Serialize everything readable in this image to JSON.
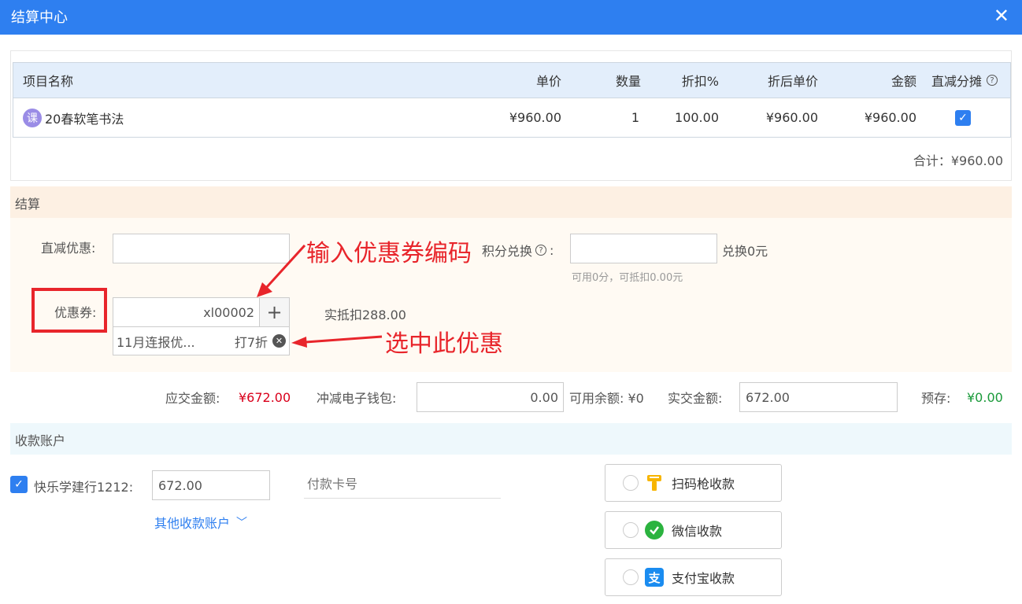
{
  "window": {
    "title": "结算中心",
    "close_glyph": "✕"
  },
  "table": {
    "headers": [
      "项目名称",
      "单价",
      "数量",
      "折扣%",
      "折后单价",
      "金额",
      "直减分摊"
    ],
    "rows": [
      {
        "type_badge": "课",
        "name": "20春软笔书法",
        "unit_price": "¥960.00",
        "qty": "1",
        "discount": "100.00",
        "disc_price": "¥960.00",
        "amount": "¥960.00",
        "allocate_checked": true
      }
    ],
    "total": "合计：¥960.00"
  },
  "settle": {
    "section_title": "结算",
    "direct_discount_label": "直减优惠:",
    "direct_discount_value": "",
    "points_label": "积分兑换",
    "points_value": "",
    "points_suffix": "兑换0元",
    "points_hint": "可用0分，可抵扣0.00元",
    "coupon_label": "优惠券:",
    "coupon_code": "xl00002",
    "coupon_add_glyph": "+",
    "coupon_deduct": "实抵扣288.00",
    "coupon_item_name": "11月连报优...",
    "coupon_item_discount": "打7折"
  },
  "annotations": {
    "enter_code": "输入优惠券编码",
    "select_coupon": "选中此优惠"
  },
  "summary": {
    "due_label": "应交金额:",
    "due_value": "¥672.00",
    "wallet_label": "冲减电子钱包:",
    "wallet_value": "0.00",
    "balance": "可用余额: ¥0",
    "actual_label": "实交金额:",
    "actual_value": "672.00",
    "prepay_label": "预存:",
    "prepay_value": "¥0.00"
  },
  "account": {
    "section_title": "收款账户",
    "account_name": "快乐学建行1212:",
    "account_checked": true,
    "account_amount": "672.00",
    "card_placeholder": "付款卡号",
    "other_accounts": "其他收款账户"
  },
  "payment_methods": [
    {
      "label": "扫码枪收款",
      "icon": "scanner-icon",
      "color": "#f7b500"
    },
    {
      "label": "微信收款",
      "icon": "wechat-icon",
      "color": "#2bb33f"
    },
    {
      "label": "支付宝收款",
      "icon": "alipay-icon",
      "color": "#1a8cf0"
    }
  ],
  "colors": {
    "primary": "#2e7ff0",
    "danger": "#d9001b",
    "success": "#1a9a3a",
    "annotation": "#e8252b"
  }
}
